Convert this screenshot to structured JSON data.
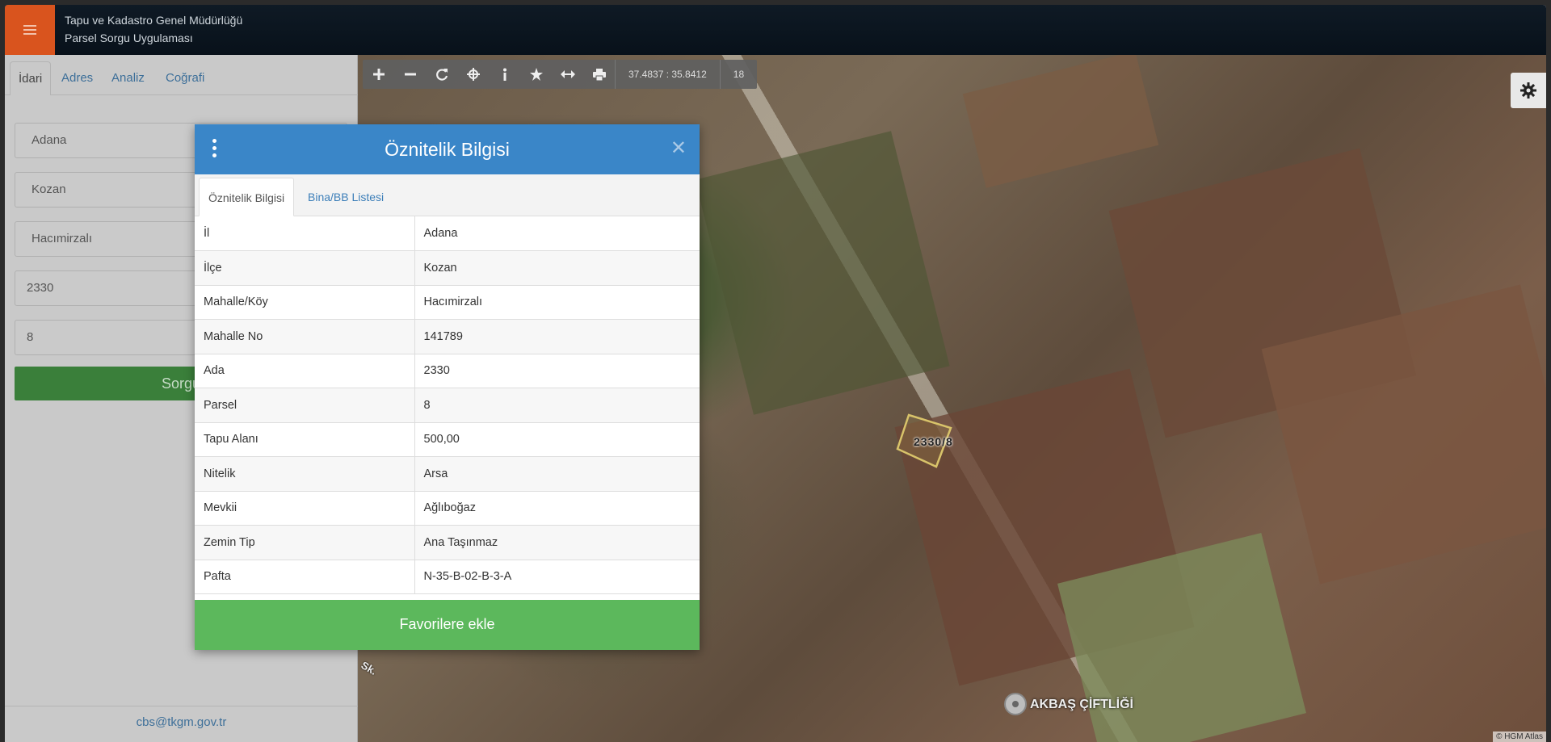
{
  "header": {
    "title": "Tapu ve Kadastro Genel Müdürlüğü",
    "subtitle": "Parsel Sorgu Uygulaması",
    "menu_icon": "hamburger-icon",
    "accent_color": "#d9541e"
  },
  "sidebar": {
    "tabs": [
      {
        "label": "İdari"
      },
      {
        "label": "Adres"
      },
      {
        "label": "Analiz"
      },
      {
        "label": "Coğrafi"
      }
    ],
    "fields": {
      "il": "Adana",
      "ilce": "Kozan",
      "mahalle": "Hacımirzalı",
      "ada": "2330",
      "parsel": "8"
    },
    "query_button": "Sorgu",
    "footer_email": "cbs@tkgm.gov.tr"
  },
  "map": {
    "toolbar": {
      "tools": [
        "plus-icon",
        "minus-icon",
        "refresh-icon",
        "crosshair-icon",
        "info-icon",
        "star-icon",
        "measure-icon",
        "print-icon"
      ],
      "coordinates": "37.4837 : 35.8412",
      "zoom": "18"
    },
    "parcel_label": "2330/8",
    "place_label": "AKBAŞ ÇİFTLİĞİ",
    "road_label": "Sk.",
    "attribution": "© HGM Atlas"
  },
  "modal": {
    "title": "Öznitelik Bilgisi",
    "tabs": [
      {
        "label": "Öznitelik Bilgisi"
      },
      {
        "label": "Bina/BB Listesi"
      }
    ],
    "rows": [
      {
        "key": "İl",
        "value": "Adana"
      },
      {
        "key": "İlçe",
        "value": "Kozan"
      },
      {
        "key": "Mahalle/Köy",
        "value": "Hacımirzalı"
      },
      {
        "key": "Mahalle No",
        "value": "141789"
      },
      {
        "key": "Ada",
        "value": "2330"
      },
      {
        "key": "Parsel",
        "value": "8"
      },
      {
        "key": "Tapu Alanı",
        "value": "500,00"
      },
      {
        "key": "Nitelik",
        "value": "Arsa"
      },
      {
        "key": "Mevkii",
        "value": "Ağlıboğaz"
      },
      {
        "key": "Zemin Tip",
        "value": "Ana Taşınmaz"
      },
      {
        "key": "Pafta",
        "value": "N-35-B-02-B-3-A"
      }
    ],
    "favorite_button": "Favorilere ekle",
    "header_color": "#3a86c8",
    "button_color": "#5cb85c"
  }
}
